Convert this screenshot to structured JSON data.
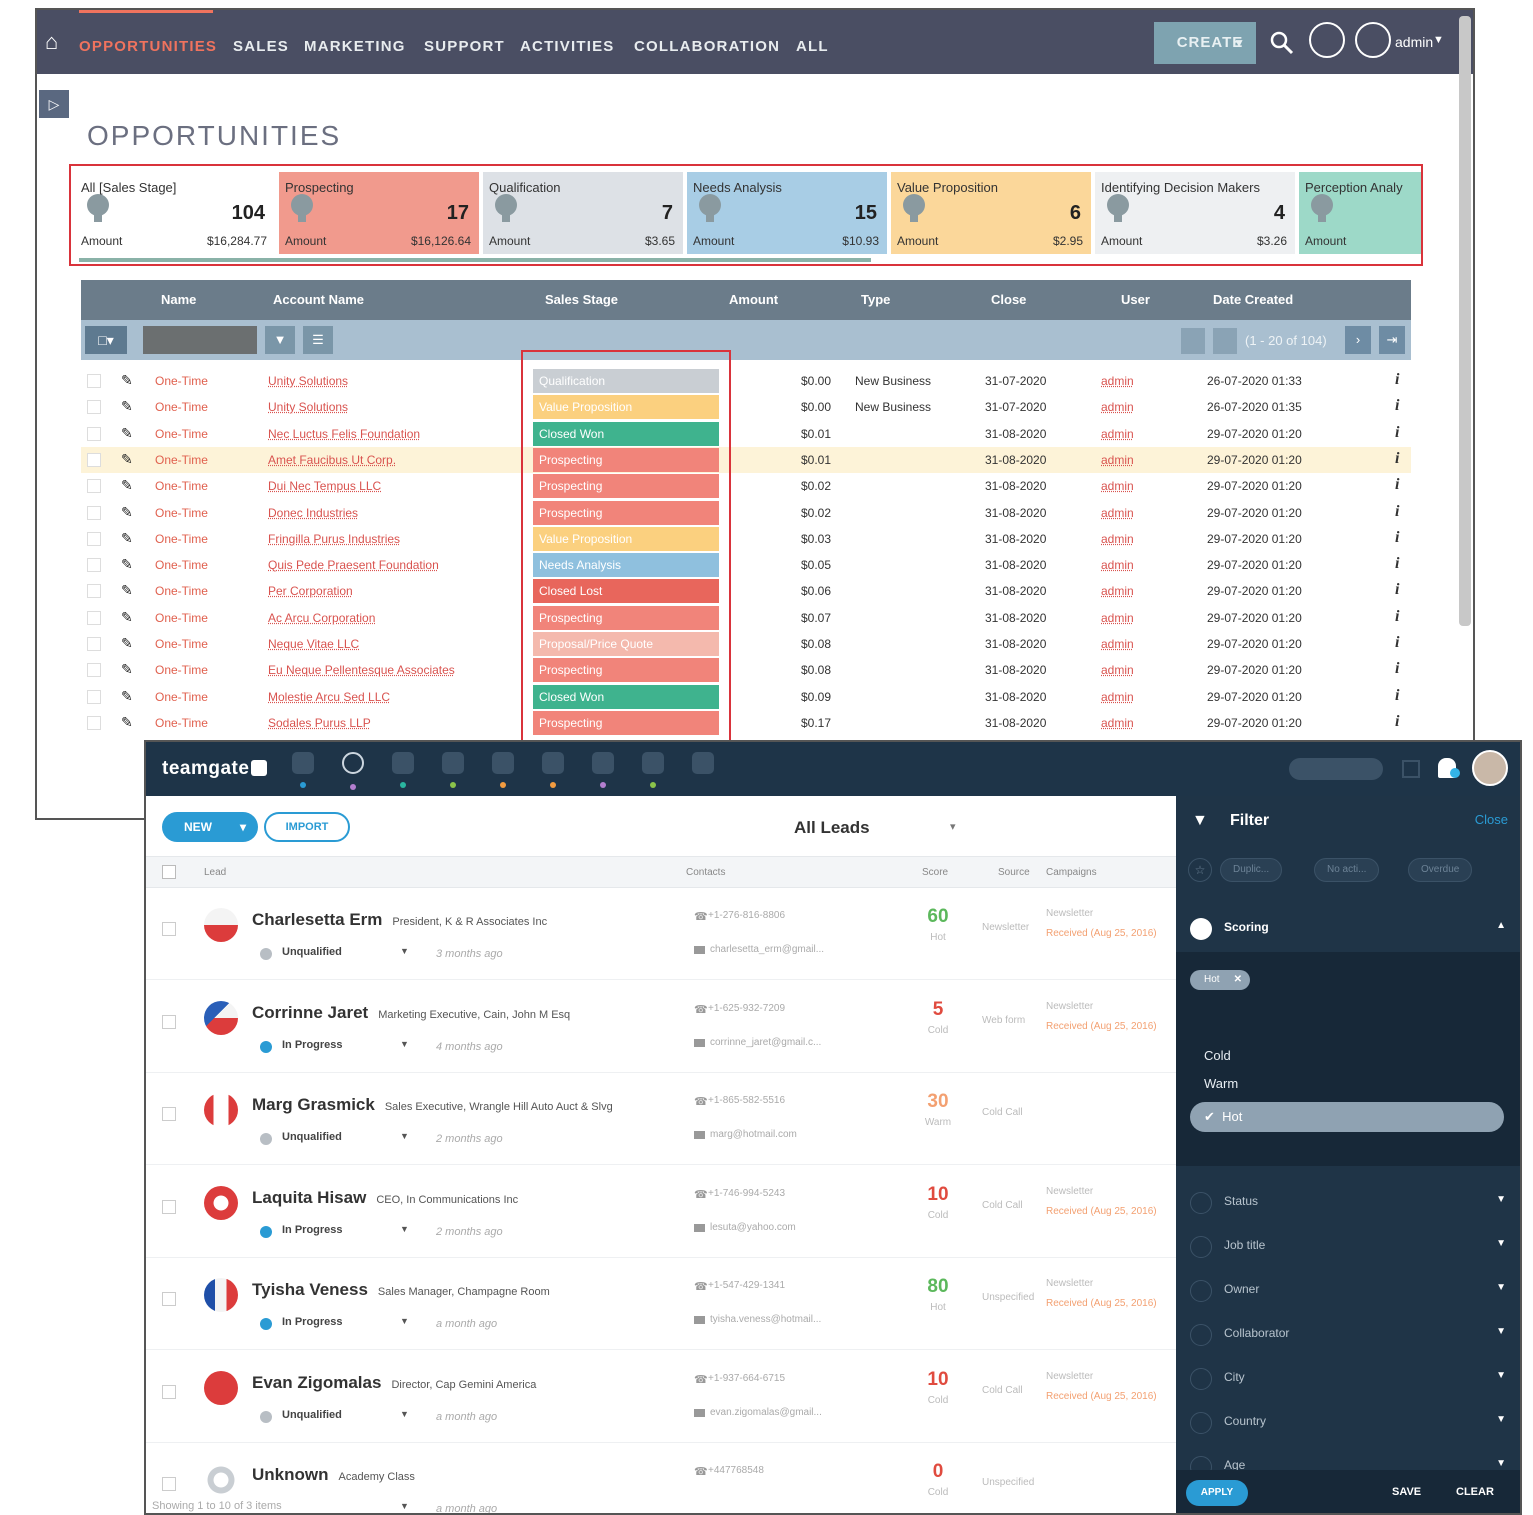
{
  "crm": {
    "nav": [
      "OPPORTUNITIES",
      "SALES",
      "MARKETING",
      "SUPPORT",
      "ACTIVITIES",
      "COLLABORATION",
      "ALL"
    ],
    "create_label": "CREATE",
    "admin_label": "admin",
    "page_title": "OPPORTUNITIES",
    "stages": [
      {
        "name": "All [Sales Stage]",
        "count": "104",
        "amount_label": "Amount",
        "amount": "$16,284.77",
        "color": "#ffffff"
      },
      {
        "name": "Prospecting",
        "count": "17",
        "amount_label": "Amount",
        "amount": "$16,126.64",
        "color": "#f19a8d"
      },
      {
        "name": "Qualification",
        "count": "7",
        "amount_label": "Amount",
        "amount": "$3.65",
        "color": "#dde1e6"
      },
      {
        "name": "Needs Analysis",
        "count": "15",
        "amount_label": "Amount",
        "amount": "$10.93",
        "color": "#a8cde5"
      },
      {
        "name": "Value Proposition",
        "count": "6",
        "amount_label": "Amount",
        "amount": "$2.95",
        "color": "#fbd79a"
      },
      {
        "name": "Identifying Decision Makers",
        "count": "4",
        "amount_label": "Amount",
        "amount": "$3.26",
        "color": "#eef0f2"
      },
      {
        "name": "Perception Analy",
        "count": "",
        "amount_label": "Amount",
        "amount": "",
        "color": "#9dd9c8"
      }
    ],
    "columns": [
      "Name",
      "Account Name",
      "Sales Stage",
      "Amount",
      "Type",
      "Close",
      "User",
      "Date Created"
    ],
    "pagination": "(1 - 20 of 104)",
    "rows": [
      {
        "name": "One-Time",
        "account": "Unity Solutions",
        "stage": "Qualification",
        "stage_color": "#c9ced3",
        "amount": "$0.00",
        "type": "New Business",
        "close": "31-07-2020",
        "user": "admin",
        "created": "26-07-2020 01:33"
      },
      {
        "name": "One-Time",
        "account": "Unity Solutions",
        "stage": "Value Proposition",
        "stage_color": "#fbd07f",
        "amount": "$0.00",
        "type": "New Business",
        "close": "31-07-2020",
        "user": "admin",
        "created": "26-07-2020 01:35"
      },
      {
        "name": "One-Time",
        "account": "Nec Luctus Felis Foundation",
        "stage": "Closed Won",
        "stage_color": "#3fb38e",
        "amount": "$0.01",
        "type": "",
        "close": "31-08-2020",
        "user": "admin",
        "created": "29-07-2020 01:20"
      },
      {
        "name": "One-Time",
        "account": "Amet Faucibus Ut Corp.",
        "stage": "Prospecting",
        "stage_color": "#f1847a",
        "amount": "$0.01",
        "type": "",
        "close": "31-08-2020",
        "user": "admin",
        "created": "29-07-2020 01:20"
      },
      {
        "name": "One-Time",
        "account": "Dui Nec Tempus LLC",
        "stage": "Prospecting",
        "stage_color": "#f1847a",
        "amount": "$0.02",
        "type": "",
        "close": "31-08-2020",
        "user": "admin",
        "created": "29-07-2020 01:20"
      },
      {
        "name": "One-Time",
        "account": "Donec Industries",
        "stage": "Prospecting",
        "stage_color": "#f1847a",
        "amount": "$0.02",
        "type": "",
        "close": "31-08-2020",
        "user": "admin",
        "created": "29-07-2020 01:20"
      },
      {
        "name": "One-Time",
        "account": "Fringilla Purus Industries",
        "stage": "Value Proposition",
        "stage_color": "#fbd07f",
        "amount": "$0.03",
        "type": "",
        "close": "31-08-2020",
        "user": "admin",
        "created": "29-07-2020 01:20"
      },
      {
        "name": "One-Time",
        "account": "Quis Pede Praesent Foundation",
        "stage": "Needs Analysis",
        "stage_color": "#8fc0de",
        "amount": "$0.05",
        "type": "",
        "close": "31-08-2020",
        "user": "admin",
        "created": "29-07-2020 01:20"
      },
      {
        "name": "One-Time",
        "account": "Per Corporation",
        "stage": "Closed Lost",
        "stage_color": "#e8665c",
        "amount": "$0.06",
        "type": "",
        "close": "31-08-2020",
        "user": "admin",
        "created": "29-07-2020 01:20"
      },
      {
        "name": "One-Time",
        "account": "Ac Arcu Corporation",
        "stage": "Prospecting",
        "stage_color": "#f1847a",
        "amount": "$0.07",
        "type": "",
        "close": "31-08-2020",
        "user": "admin",
        "created": "29-07-2020 01:20"
      },
      {
        "name": "One-Time",
        "account": "Neque Vitae LLC",
        "stage": "Proposal/Price Quote",
        "stage_color": "#f4b9ad",
        "amount": "$0.08",
        "type": "",
        "close": "31-08-2020",
        "user": "admin",
        "created": "29-07-2020 01:20"
      },
      {
        "name": "One-Time",
        "account": "Eu Neque Pellentesque Associates",
        "stage": "Prospecting",
        "stage_color": "#f1847a",
        "amount": "$0.08",
        "type": "",
        "close": "31-08-2020",
        "user": "admin",
        "created": "29-07-2020 01:20"
      },
      {
        "name": "One-Time",
        "account": "Molestie Arcu Sed LLC",
        "stage": "Closed Won",
        "stage_color": "#3fb38e",
        "amount": "$0.09",
        "type": "",
        "close": "31-08-2020",
        "user": "admin",
        "created": "29-07-2020 01:20"
      },
      {
        "name": "One-Time",
        "account": "Sodales Purus LLP",
        "stage": "Prospecting",
        "stage_color": "#f1847a",
        "amount": "$0.17",
        "type": "",
        "close": "31-08-2020",
        "user": "admin",
        "created": "29-07-2020 01:20"
      }
    ]
  },
  "tg": {
    "logo": "teamgate",
    "new_label": "NEW",
    "import_label": "IMPORT",
    "view_title": "All Leads",
    "headers": [
      "Lead",
      "Contacts",
      "Score",
      "Source",
      "Campaigns"
    ],
    "leads": [
      {
        "name": "Charlesetta Erm",
        "title": "President, K & R Associates Inc",
        "status": "Unqualified",
        "status_color": "#b8bec4",
        "time": "3 months ago",
        "phone": "+1-276-816-8806",
        "email": "charlesetta_erm@gmail...",
        "score": "60",
        "score_label": "Hot",
        "score_color": "#5cb85c",
        "source": "Newsletter",
        "campaign": "Newsletter",
        "campaign2": "Received (Aug 25, 2016)",
        "flag": "poland"
      },
      {
        "name": "Corrinne Jaret",
        "title": "Marketing Executive, Cain, John M Esq",
        "status": "In Progress",
        "status_color": "#2a9bd4",
        "time": "4 months ago",
        "phone": "+1-625-932-7209",
        "email": "corrinne_jaret@gmail.c...",
        "score": "5",
        "score_label": "Cold",
        "score_color": "#e04b3f",
        "source": "Web form",
        "campaign": "Newsletter",
        "campaign2": "Received (Aug 25, 2016)",
        "flag": "czech"
      },
      {
        "name": "Marg Grasmick",
        "title": "Sales Executive, Wrangle Hill Auto Auct & Slvg",
        "status": "Unqualified",
        "status_color": "#b8bec4",
        "time": "2 months ago",
        "phone": "+1-865-582-5516",
        "email": "marg@hotmail.com",
        "score": "30",
        "score_label": "Warm",
        "score_color": "#f3a071",
        "source": "Cold Call",
        "campaign": "",
        "campaign2": "",
        "flag": "canada"
      },
      {
        "name": "Laquita Hisaw",
        "title": "CEO, In Communications Inc",
        "status": "In Progress",
        "status_color": "#2a9bd4",
        "time": "2 months ago",
        "phone": "+1-746-994-5243",
        "email": "lesuta@yahoo.com",
        "score": "10",
        "score_label": "Cold",
        "score_color": "#e04b3f",
        "source": "Cold Call",
        "campaign": "Newsletter",
        "campaign2": "Received (Aug 25, 2016)",
        "flag": "hongkong"
      },
      {
        "name": "Tyisha Veness",
        "title": "Sales Manager, Champagne Room",
        "status": "In Progress",
        "status_color": "#2a9bd4",
        "time": "a month ago",
        "phone": "+1-547-429-1341",
        "email": "tyisha.veness@hotmail...",
        "score": "80",
        "score_label": "Hot",
        "score_color": "#5cb85c",
        "source": "Unspecified",
        "campaign": "Newsletter",
        "campaign2": "Received (Aug 25, 2016)",
        "flag": "france"
      },
      {
        "name": "Evan Zigomalas",
        "title": "Director, Cap Gemini America",
        "status": "Unqualified",
        "status_color": "#b8bec4",
        "time": "a month ago",
        "phone": "+1-937-664-6715",
        "email": "evan.zigomalas@gmail...",
        "score": "10",
        "score_label": "Cold",
        "score_color": "#e04b3f",
        "source": "Cold Call",
        "campaign": "Newsletter",
        "campaign2": "Received (Aug 25, 2016)",
        "flag": "japan"
      },
      {
        "name": "Unknown",
        "title": "Academy Class",
        "status": "",
        "status_color": "#b8bec4",
        "time": "a month ago",
        "phone": "+447768548",
        "email": "",
        "score": "0",
        "score_label": "Cold",
        "score_color": "#e04b3f",
        "source": "Unspecified",
        "campaign": "",
        "campaign2": "",
        "flag": "unknown"
      }
    ],
    "footer": "Showing 1 to 10 of 3 items",
    "filter": {
      "title": "Filter",
      "close": "Close",
      "pills": [
        "Duplic...",
        "No acti...",
        "Overdue"
      ],
      "scoring_label": "Scoring",
      "hot_chip": "Hot",
      "options": [
        "Cold",
        "Warm",
        "Hot"
      ],
      "sections": [
        "Status",
        "Job title",
        "Owner",
        "Collaborator",
        "City",
        "Country",
        "Age"
      ],
      "apply": "APPLY",
      "save": "SAVE",
      "clear": "CLEAR"
    }
  }
}
